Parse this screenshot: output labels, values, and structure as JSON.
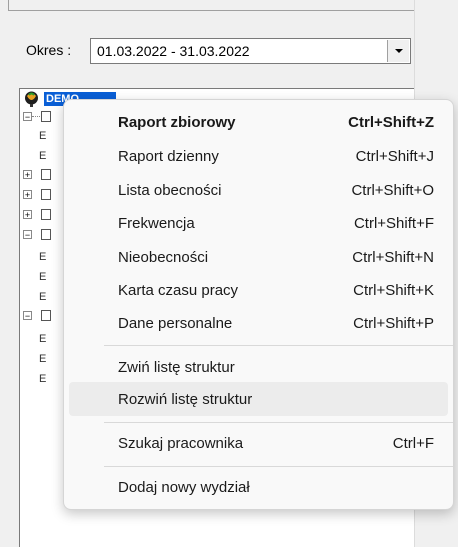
{
  "period": {
    "label": "Okres :",
    "value": "01.03.2022 - 31.03.2022"
  },
  "tree": {
    "root_label": "DEMO"
  },
  "context_menu": {
    "items": [
      {
        "label": "Raport zbiorowy",
        "shortcut": "Ctrl+Shift+Z",
        "bold": true
      },
      {
        "label": "Raport dzienny",
        "shortcut": "Ctrl+Shift+J"
      },
      {
        "label": "Lista obecności",
        "shortcut": "Ctrl+Shift+O"
      },
      {
        "label": "Frekwencja",
        "shortcut": "Ctrl+Shift+F"
      },
      {
        "label": "Nieobecności",
        "shortcut": "Ctrl+Shift+N"
      },
      {
        "label": "Karta czasu pracy",
        "shortcut": "Ctrl+Shift+K"
      },
      {
        "label": "Dane personalne",
        "shortcut": "Ctrl+Shift+P"
      },
      {
        "label": "Zwiń listę struktur",
        "shortcut": ""
      },
      {
        "label": "Rozwiń listę struktur",
        "shortcut": "",
        "highlighted": true
      },
      {
        "label": "Szukaj pracownika",
        "shortcut": "Ctrl+F"
      },
      {
        "label": "Dodaj nowy wydział",
        "shortcut": ""
      }
    ]
  },
  "colors": {
    "selection": "#0a5fd6",
    "menu_hover": "#ececec"
  }
}
